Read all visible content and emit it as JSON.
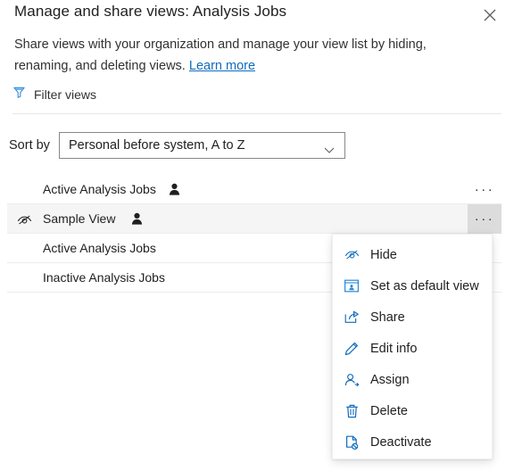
{
  "dialog": {
    "title": "Manage and share views: Analysis Jobs",
    "close_icon": "close-icon",
    "description_part1": "Share views with your organization and manage your view list by hiding, renaming, and deleting views. ",
    "learn_more": "Learn more"
  },
  "filter": {
    "icon": "filter-funnel-icon",
    "label": "Filter views"
  },
  "sort": {
    "label": "Sort by",
    "value": "Personal before system, A to Z",
    "chevron_icon": "chevron-down-icon"
  },
  "views": [
    {
      "name": "Active Analysis Jobs",
      "hidden": false,
      "personal": true,
      "selected": false,
      "more_label": "···"
    },
    {
      "name": "Sample View",
      "hidden": true,
      "personal": true,
      "selected": true,
      "more_label": "···"
    },
    {
      "name": "Active Analysis Jobs",
      "hidden": false,
      "personal": false,
      "selected": false,
      "more_label": ""
    },
    {
      "name": "Inactive Analysis Jobs",
      "hidden": false,
      "personal": false,
      "selected": false,
      "more_label": ""
    }
  ],
  "context_menu": {
    "items": [
      {
        "label": "Hide",
        "icon": "eye-slash-icon"
      },
      {
        "label": "Set as default view",
        "icon": "default-view-card-icon"
      },
      {
        "label": "Share",
        "icon": "share-arrow-icon"
      },
      {
        "label": "Edit info",
        "icon": "pencil-icon"
      },
      {
        "label": "Assign",
        "icon": "person-assign-icon"
      },
      {
        "label": "Delete",
        "icon": "trash-icon"
      },
      {
        "label": "Deactivate",
        "icon": "document-deactivate-icon"
      }
    ]
  },
  "colors": {
    "accent": "#0f6cbd",
    "link": "#0f6cbd",
    "text": "#201f1e",
    "row_selected_bg": "#f5f5f5",
    "more_hover_bg": "#dcdcdc",
    "divider": "#e6e6e6"
  }
}
